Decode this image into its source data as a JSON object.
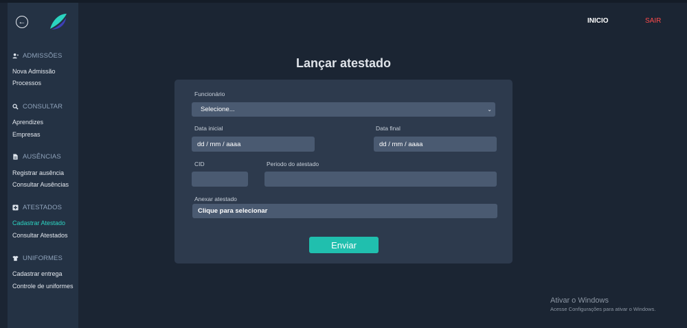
{
  "sidebar": {
    "back_icon": "arrow-left-circle-icon",
    "sections": [
      {
        "title": "ADMISSÕES",
        "icon": "user-plus-icon",
        "items": [
          "Nova Admissão",
          "Processos"
        ]
      },
      {
        "title": "CONSULTAR",
        "icon": "search-icon",
        "items": [
          "Aprendizes",
          "Empresas"
        ]
      },
      {
        "title": "AUSÊNCIAS",
        "icon": "document-icon",
        "items": [
          "Registrar ausência",
          "Consultar Ausências"
        ]
      },
      {
        "title": "ATESTADOS",
        "icon": "medical-plus-icon",
        "items": [
          "Cadastrar Atestado",
          "Consultar Atestados"
        ]
      },
      {
        "title": "UNIFORMES",
        "icon": "shirt-icon",
        "items": [
          "Cadastrar entrega",
          "Controle de uniformes"
        ]
      }
    ],
    "active_item": "Cadastrar Atestado"
  },
  "header": {
    "inicio_label": "INICIO",
    "sair_label": "SAIR"
  },
  "form": {
    "title": "Lançar atestado",
    "funcionario_label": "Funcionário",
    "funcionario_value": "Selecione...",
    "data_inicial_label": "Data inicial",
    "data_inicial_value": "dd / mm / aaaa",
    "data_final_label": "Data final",
    "data_final_value": "dd / mm / aaaa",
    "cid_label": "CID",
    "cid_value": "",
    "periodo_label": "Periodo do atestado",
    "periodo_value": "",
    "anexar_label": "Anexar atestado",
    "anexar_value": "Clique para selecionar",
    "submit_label": "Enviar"
  },
  "watermark": {
    "title": "Ativar o Windows",
    "subtitle": "Acesse Configurações para ativar o Windows."
  },
  "colors": {
    "background": "#1b2533",
    "sidebar": "#243244",
    "card": "#2d3a4d",
    "input": "#4a5a71",
    "accent": "#20bfae",
    "active_nav": "#2dd4c2",
    "logout": "#ff4b4b"
  }
}
